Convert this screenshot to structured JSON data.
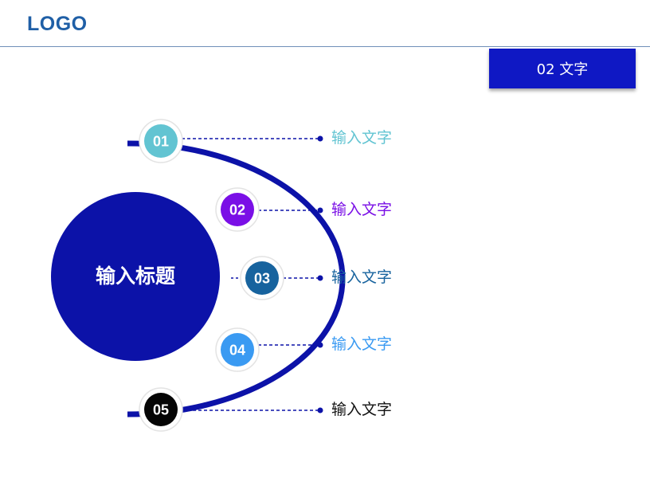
{
  "header": {
    "logo": "LOGO"
  },
  "section_button": {
    "label": "02 文字"
  },
  "diagram": {
    "title": "输入标题",
    "title_circle_color": "#0c12a8",
    "arc_color": "#0c12a8",
    "items": [
      {
        "number": "01",
        "label": "输入文字",
        "color": "#62c4d2",
        "label_color": "#62c4d2"
      },
      {
        "number": "02",
        "label": "输入文字",
        "color": "#7a0fe6",
        "label_color": "#7a0fe6"
      },
      {
        "number": "03",
        "label": "输入文字",
        "color": "#17639e",
        "label_color": "#17639e"
      },
      {
        "number": "04",
        "label": "输入文字",
        "color": "#3a9af2",
        "label_color": "#3a9af2"
      },
      {
        "number": "05",
        "label": "输入文字",
        "color": "#050505",
        "label_color": "#111111"
      }
    ]
  }
}
